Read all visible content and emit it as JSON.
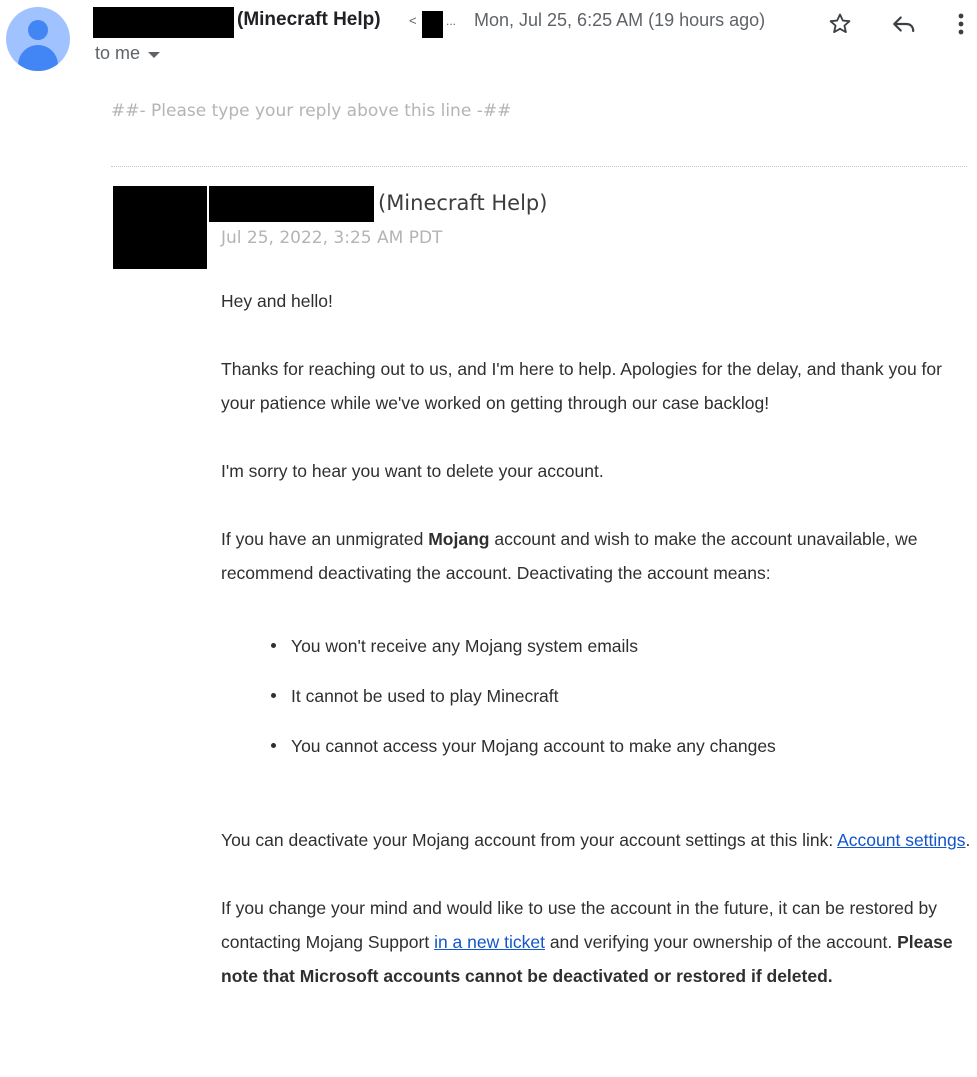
{
  "header": {
    "sender_org": "(Minecraft Help)",
    "email_open": "<",
    "email_trunc": "...",
    "date": "Mon, Jul 25, 6:25 AM (19 hours ago)",
    "to_label": "to me",
    "icons": [
      "star-icon",
      "reply-icon",
      "more-vertical-icon"
    ]
  },
  "reply_marker": "##- Please type your reply above this line -##",
  "message": {
    "author_org": "(Minecraft Help)",
    "date": "Jul 25, 2022, 3:25 AM PDT",
    "greeting": "Hey and hello!",
    "p1": "Thanks for reaching out to us, and I'm here to help.  Apologies for the delay, and thank you for your patience while we've worked on getting through our case backlog!",
    "p2": "I'm sorry to hear you want to delete your account.",
    "p3_before": "If you have an unmigrated ",
    "p3_bold": "Mojang",
    "p3_after": " account and wish to make the account unavailable, we recommend deactivating the account. Deactivating the account means:",
    "bullets": [
      "You won't receive any Mojang system emails",
      "It cannot be used to play Minecraft",
      "You cannot access your Mojang account to make any changes"
    ],
    "p4_before": "You can deactivate your Mojang account from your account settings at this link: ",
    "p4_link": "Account settings",
    "p4_after": ".",
    "p5_before": "If you change your mind and would like to use the account in the future, it can be restored by contacting Mojang Support ",
    "p5_link": "in a new ticket",
    "p5_mid": " and verifying your ownership of the account. ",
    "p5_bold": "Please note that Microsoft accounts cannot be deactivated or restored if deleted."
  },
  "colors": {
    "link": "#1155cc",
    "muted": "#b4b4b4",
    "avatar_bg": "#a0c3ff",
    "avatar_fg": "#4285f4"
  }
}
